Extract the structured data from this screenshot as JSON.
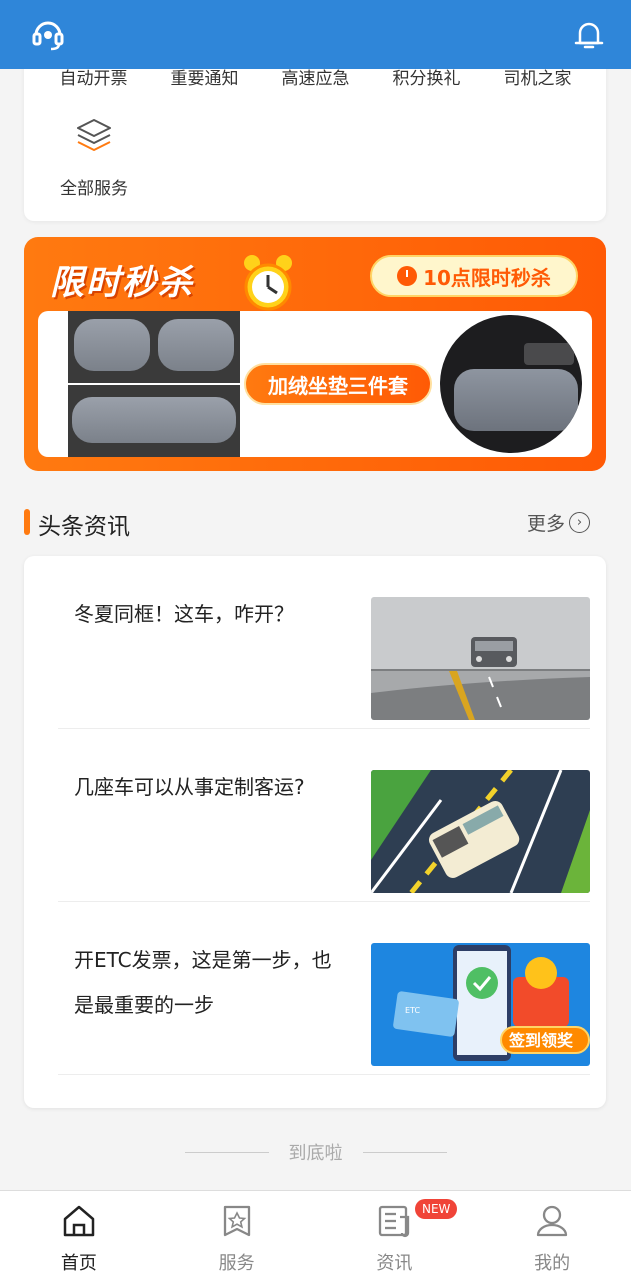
{
  "header": {
    "left_icon": "headset-icon",
    "right_icon": "bell-icon",
    "bg_color": "#2f86d9"
  },
  "services": {
    "items": [
      "自动开票",
      "重要通知",
      "高速应急",
      "积分换礼",
      "司机之家"
    ],
    "all_label": "全部服务",
    "all_icon": "layers-icon"
  },
  "banner": {
    "title": "限时秒杀",
    "pill": "10点限时秒杀",
    "product": "加绒坐垫三件套",
    "accent": "#ff6a0a"
  },
  "news": {
    "section_title": "头条资讯",
    "more_label": "更多",
    "items": [
      {
        "title": "冬夏同框！这车，咋开？"
      },
      {
        "title": "几座车可以从事定制客运?"
      },
      {
        "title": "开ETC发票，这是第一步，也是最重要的一步"
      }
    ],
    "third_thumb_text": "签到领奖",
    "third_thumb_card": "ETC"
  },
  "footer_note": "到底啦",
  "bottom_nav": {
    "items": [
      {
        "label": "首页",
        "icon": "home-icon",
        "active": true
      },
      {
        "label": "服务",
        "icon": "service-star-icon",
        "active": false
      },
      {
        "label": "资讯",
        "icon": "news-icon",
        "active": false
      },
      {
        "label": "我的",
        "icon": "user-icon",
        "active": false
      }
    ],
    "badge": "NEW"
  }
}
